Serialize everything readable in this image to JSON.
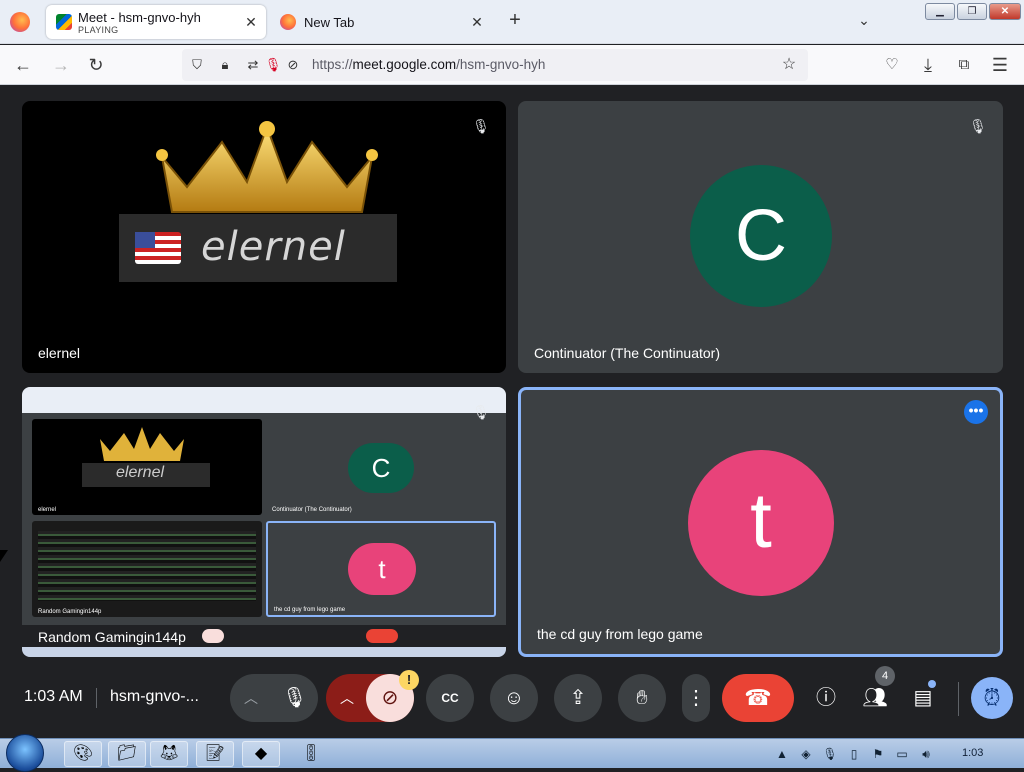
{
  "browser": {
    "tabs": [
      {
        "title": "Meet - hsm-gnvo-hyh",
        "subtitle": "PLAYING",
        "active": true
      },
      {
        "title": "New Tab",
        "active": false
      }
    ],
    "url_prefix": "https://",
    "url_domain": "meet.google.com",
    "url_path": "/hsm-gnvo-hyh"
  },
  "tiles": [
    {
      "name": "elernel",
      "banner_text": "elernel"
    },
    {
      "name": "Continuator (The Continuator)",
      "avatar_letter": "C",
      "avatar_color": "#0b5e4a"
    },
    {
      "name": "Random Gamingin144p",
      "mini": {
        "banner_text": "elernel",
        "avatar_c": "C",
        "name_c": "Continuator (The Continuator)",
        "avatar_t": "t",
        "name_t": "the cd guy from lego game",
        "name_e": "elernel",
        "name_r": "Random Gamingin144p"
      }
    },
    {
      "name": "the cd guy from lego game",
      "avatar_letter": "t",
      "avatar_color": "#e8437a"
    }
  ],
  "controls": {
    "time": "1:03 AM",
    "meeting_code": "hsm-gnvo-...",
    "people_count": "4",
    "warning": "!"
  },
  "taskbar": {
    "time": "1:03"
  }
}
